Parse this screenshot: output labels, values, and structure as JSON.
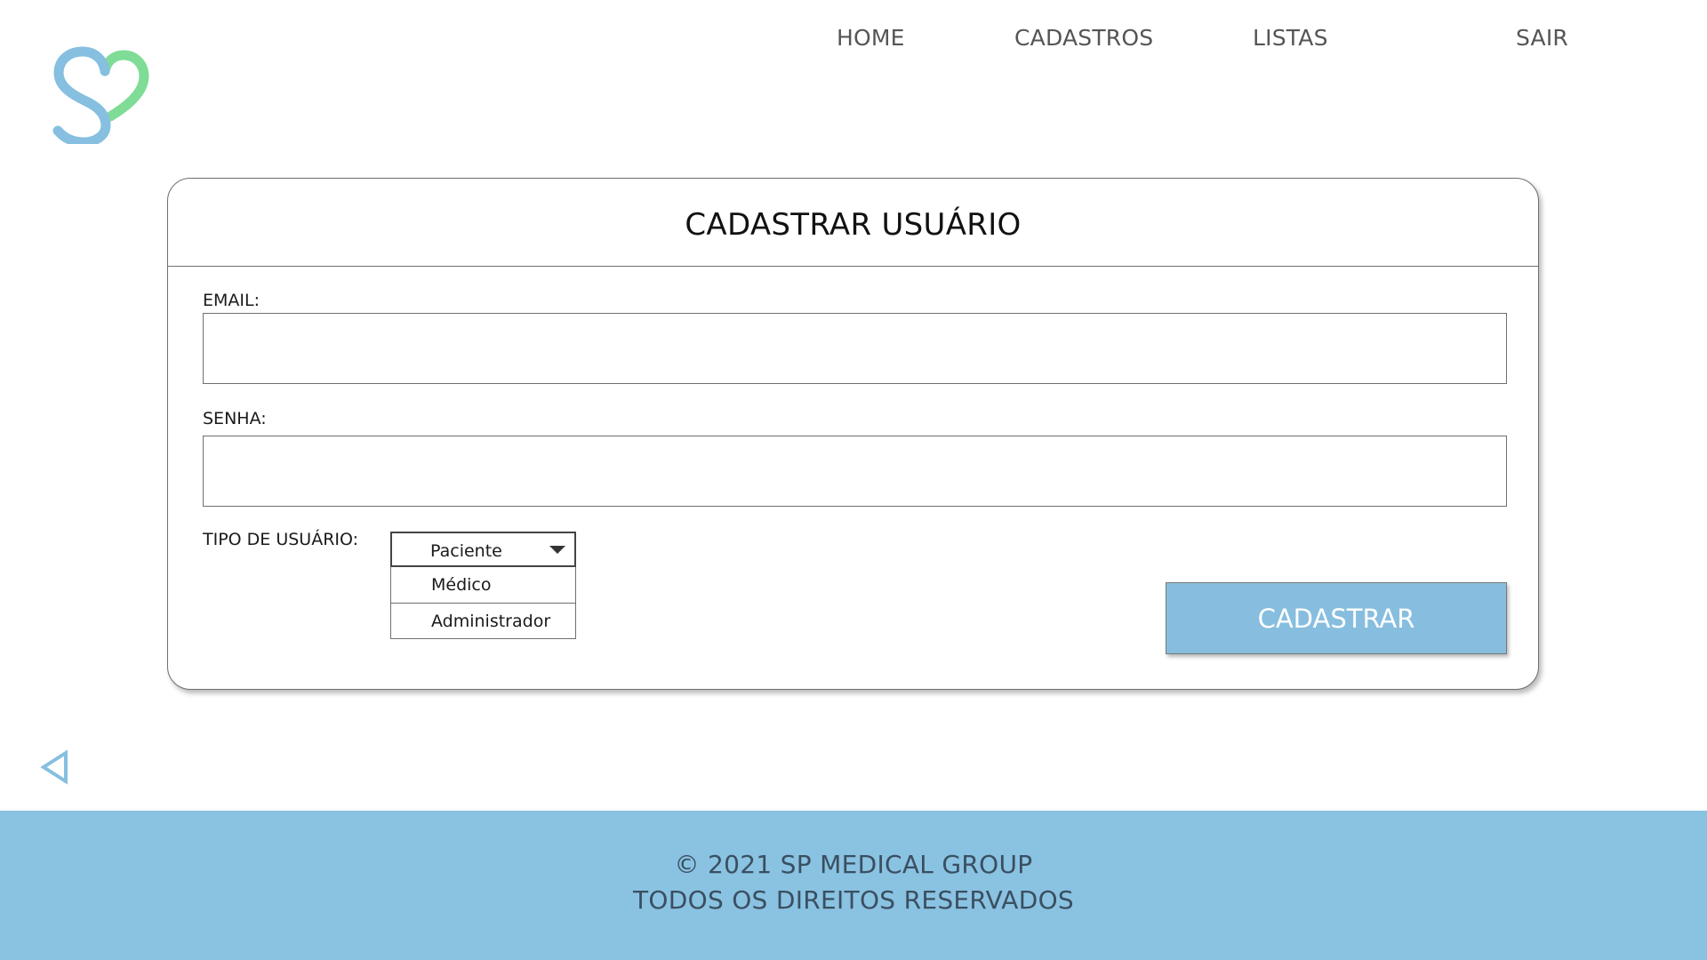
{
  "brand": {
    "logo_icon": "heart-s-logo-icon",
    "colors": {
      "logo_blue": "#86bfe0",
      "logo_green": "#7fdc96",
      "accent": "#87bedf",
      "footer_bg": "#8ac2e2",
      "footer_text": "#3a4f60",
      "nav_text": "#555555"
    }
  },
  "nav": {
    "items": [
      {
        "label": "HOME"
      },
      {
        "label": "CADASTROS"
      },
      {
        "label": "LISTAS"
      },
      {
        "label": "SAIR"
      }
    ]
  },
  "form": {
    "title": "CADASTRAR USUÁRIO",
    "email": {
      "label": "EMAIL:",
      "value": "",
      "placeholder": ""
    },
    "senha": {
      "label": "SENHA:",
      "value": "",
      "placeholder": ""
    },
    "tipo": {
      "label": "TIPO DE USUÁRIO:",
      "selected": "Paciente",
      "open": true,
      "options": [
        "Médico",
        "Administrador"
      ],
      "caret_icon": "caret-down-icon"
    },
    "submit_label": "CADASTRAR"
  },
  "back": {
    "icon": "back-triangle-icon"
  },
  "footer": {
    "line1": "© 2021 SP MEDICAL GROUP",
    "line2": "TODOS OS DIREITOS RESERVADOS"
  }
}
